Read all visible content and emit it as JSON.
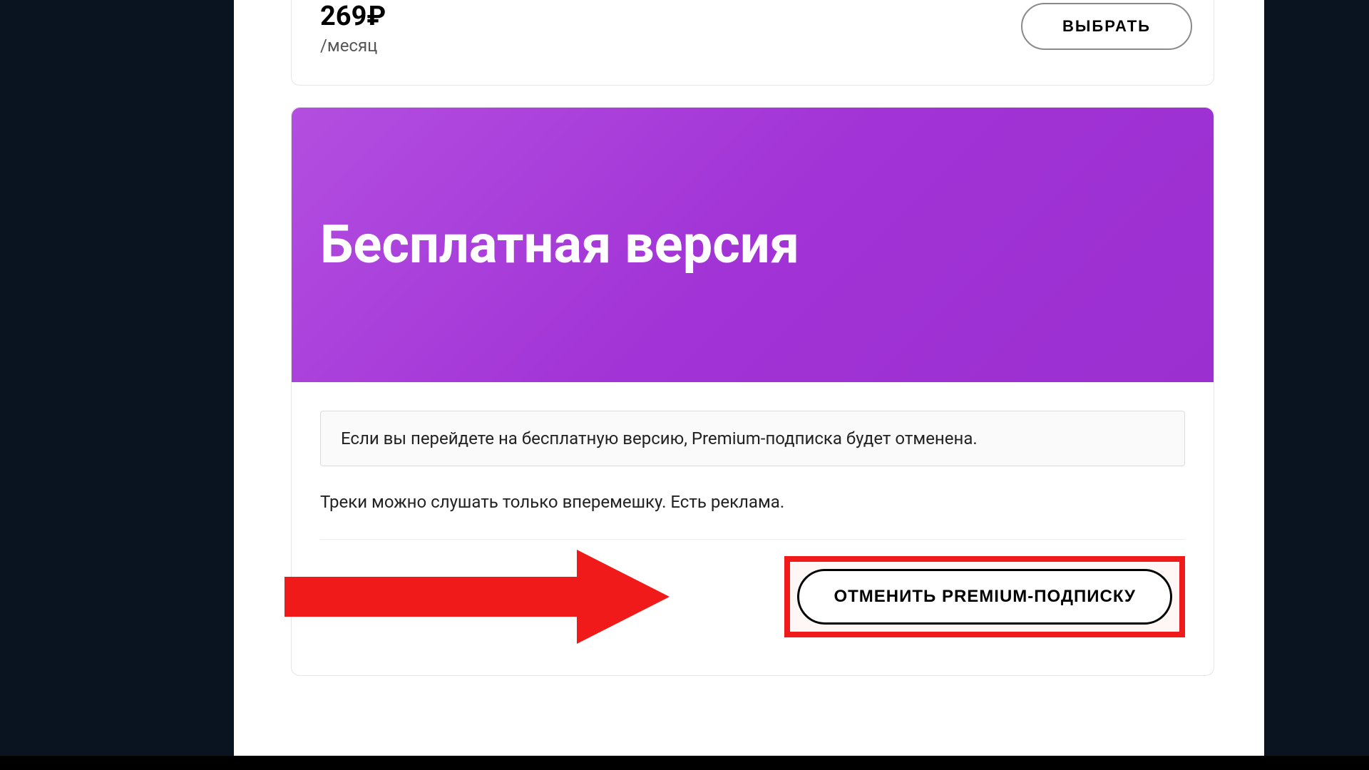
{
  "top_plan": {
    "price": "269₽",
    "period": "/месяц",
    "select_label": "ВЫБРАТЬ"
  },
  "free_plan": {
    "title": "Бесплатная версия",
    "warning": "Если вы перейдете на бесплатную версию, Premium-подписка будет отменена.",
    "description": "Треки можно слушать только вперемешку. Есть реклама.",
    "cancel_label": "ОТМЕНИТЬ PREMIUM-ПОДПИСКУ"
  },
  "annotation": {
    "arrow_color": "#f01a1a",
    "highlight_color": "#f01a1a"
  }
}
